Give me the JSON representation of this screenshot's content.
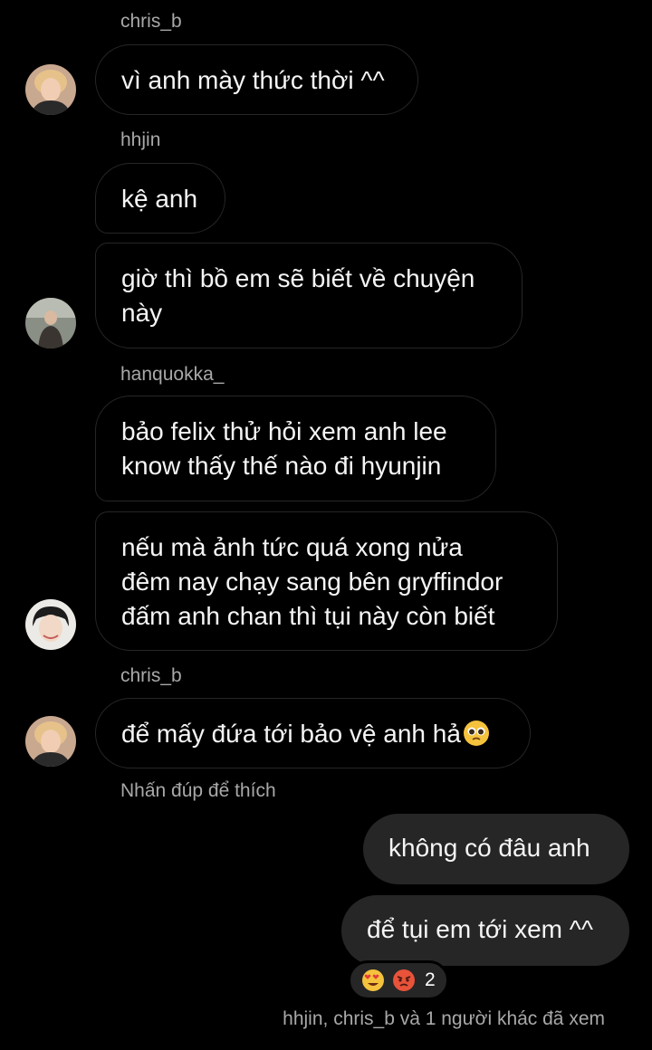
{
  "messages": [
    {
      "sender": "chris_b",
      "text": "vì anh mày thức thời ^^"
    },
    {
      "sender": "hhjin",
      "text": "kệ anh"
    },
    {
      "text_line1": "giờ thì bồ em sẽ biết về chuyện",
      "text_line2": "này"
    },
    {
      "sender": "hanquokka_",
      "text_line1": "bảo felix thử hỏi xem anh lee",
      "text_line2": "know thấy thế nào đi hyunjin"
    },
    {
      "text_line1": "nếu mà ảnh tức quá xong nửa",
      "text_line2": "đêm nay chạy sang bên gryffindor",
      "text_line3": "đấm anh chan thì tụi này còn biết"
    },
    {
      "sender": "chris_b",
      "text": "để mấy đứa tới bảo vệ anh hả",
      "emoji": "pleading-face"
    }
  ],
  "double_tap_hint": "Nhấn đúp để thích",
  "outgoing": [
    {
      "text": "không có đâu anh"
    },
    {
      "text": "để tụi em tới xem ^^"
    }
  ],
  "reactions": {
    "emojis": [
      "heart-eyes-face",
      "angry-face"
    ],
    "count": "2"
  },
  "seen_by": "hhjin, chris_b và 1 người khác đã xem"
}
